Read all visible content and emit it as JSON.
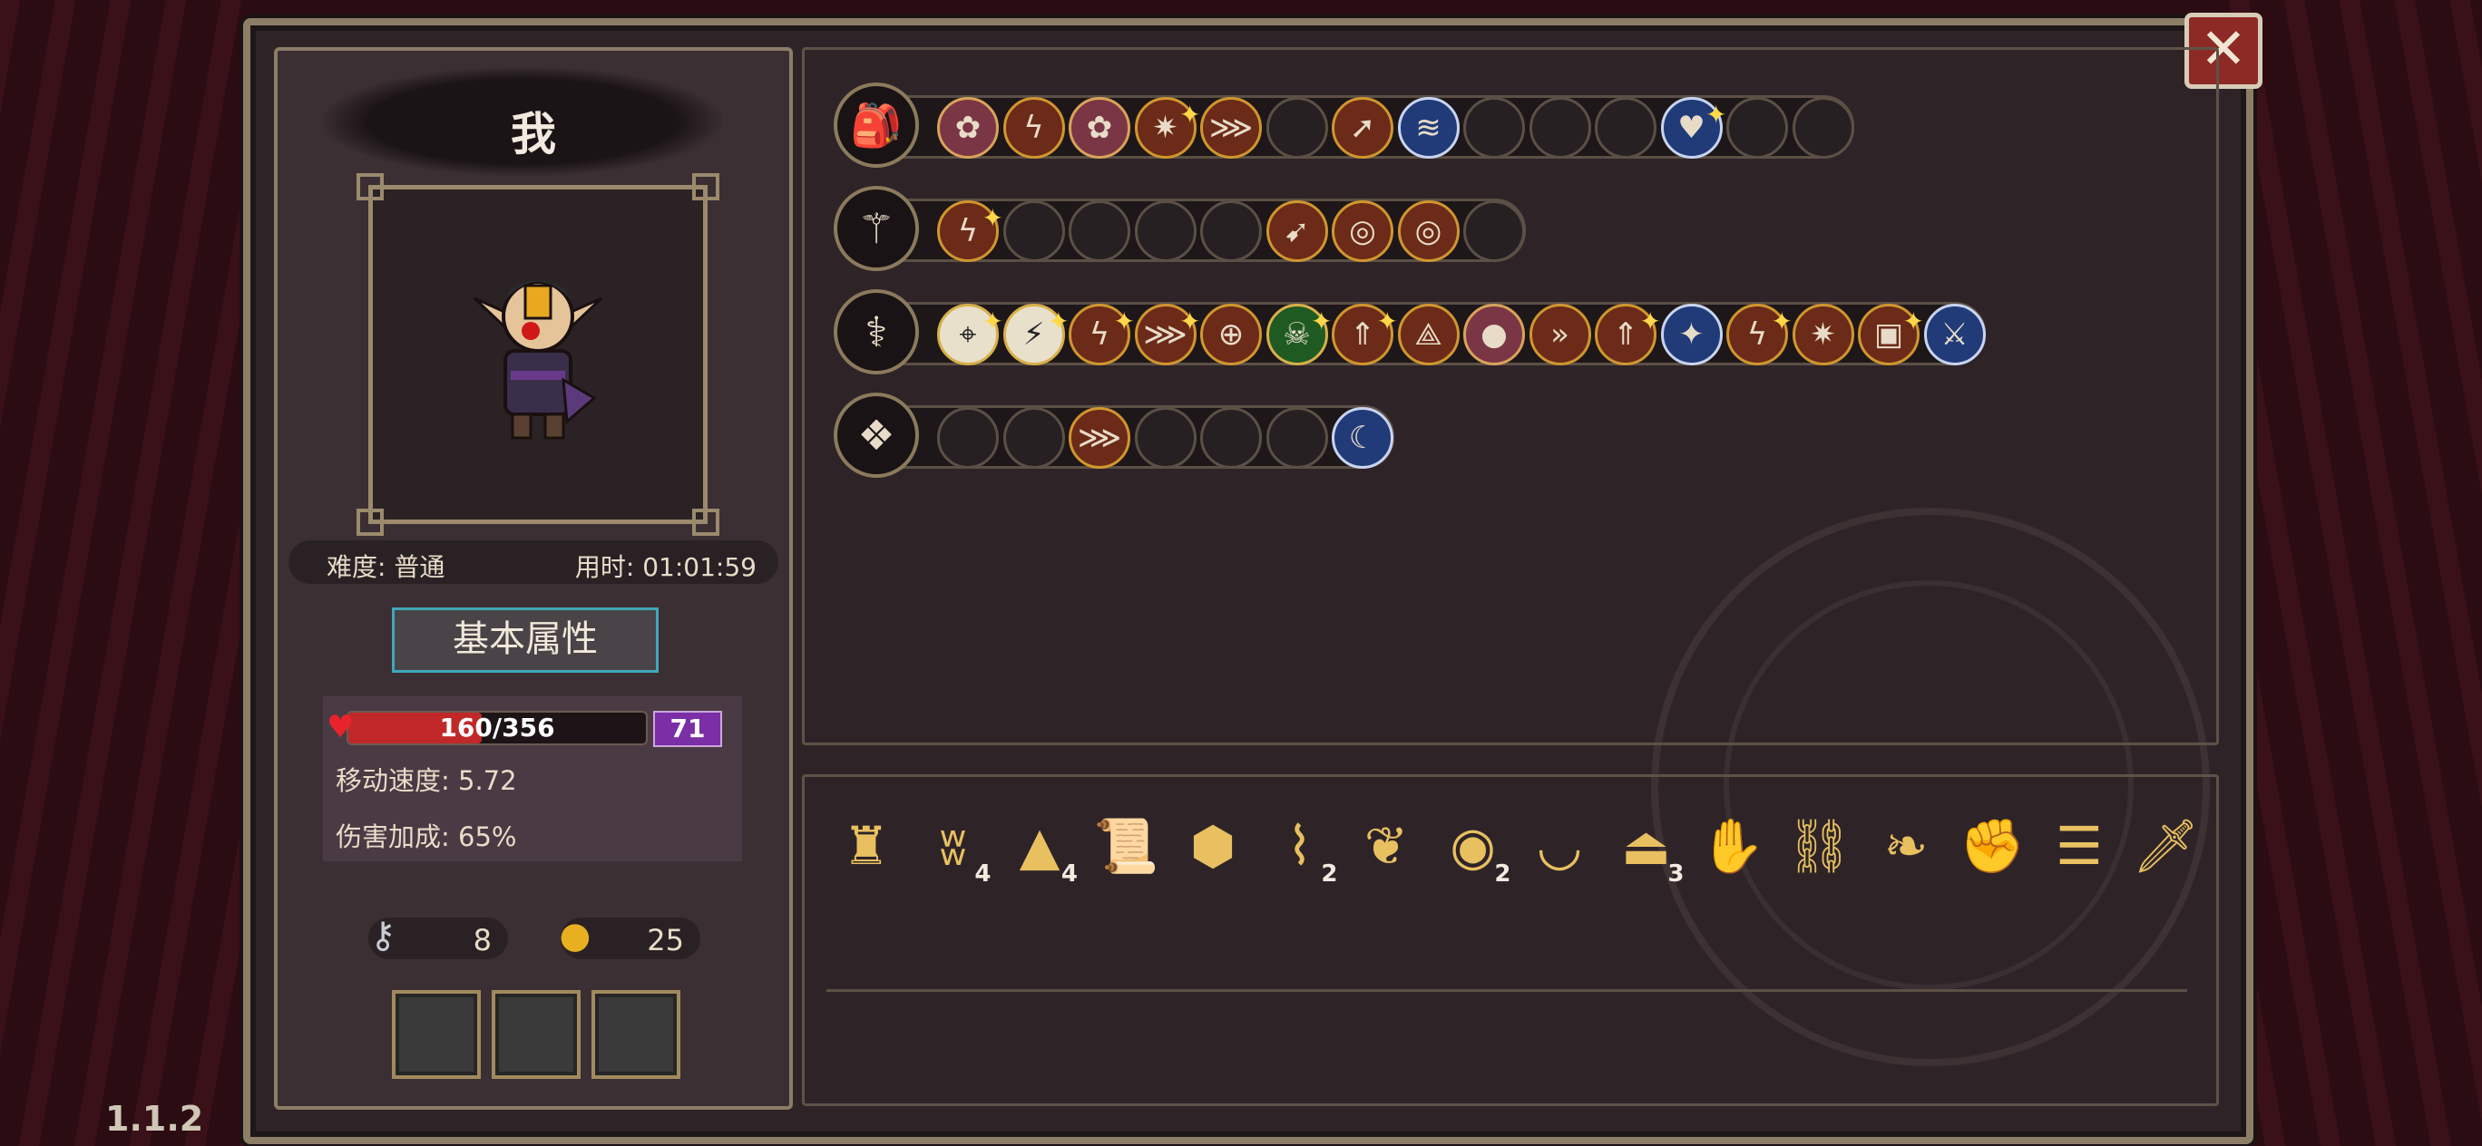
{
  "version": "1.1.2",
  "close_label": "✕",
  "character": {
    "name": "我",
    "difficulty": "难度: 普通",
    "time": "用时: 01:01:59",
    "attributes_button": "基本属性",
    "hp_text": "160/356",
    "hp_fraction": 0.449,
    "shield": "71",
    "move_speed": "移动速度: 5.72",
    "damage_bonus": "伤害加成: 65%",
    "keys": "8",
    "coins": "25"
  },
  "skill_rows": [
    {
      "weapon_icon": "backpack-icon",
      "glyph": "🎒",
      "skills": [
        {
          "icon": "lotus-icon",
          "glyph": "✿",
          "style": "pink"
        },
        {
          "icon": "lightning-icon",
          "glyph": "ϟ",
          "style": "fire"
        },
        {
          "icon": "lotus-icon",
          "glyph": "✿",
          "style": "pink"
        },
        {
          "icon": "burst-icon",
          "glyph": "✷",
          "style": "fire",
          "star": true
        },
        {
          "icon": "claw-icon",
          "glyph": "⋙",
          "style": "fire"
        },
        {
          "icon": "empty-slot-icon",
          "glyph": "",
          "style": ""
        },
        {
          "icon": "arrow-up-icon",
          "glyph": "➚",
          "style": "fire"
        },
        {
          "icon": "splash-icon",
          "glyph": "≋",
          "style": "blue"
        },
        {
          "icon": "empty-slot-icon",
          "glyph": "",
          "style": ""
        },
        {
          "icon": "empty-slot-icon",
          "glyph": "",
          "style": ""
        },
        {
          "icon": "empty-slot-icon",
          "glyph": "",
          "style": ""
        },
        {
          "icon": "shield-heart-icon",
          "glyph": "♥",
          "style": "blue",
          "star": true
        },
        {
          "icon": "empty-slot-icon",
          "glyph": "",
          "style": ""
        },
        {
          "icon": "empty-slot-icon",
          "glyph": "",
          "style": ""
        }
      ]
    },
    {
      "weapon_icon": "staff-icon",
      "glyph": "⚚",
      "skills": [
        {
          "icon": "lightning-icon",
          "glyph": "ϟ",
          "style": "fire",
          "star": true
        },
        {
          "icon": "empty-slot-icon",
          "glyph": "",
          "style": ""
        },
        {
          "icon": "empty-slot-icon",
          "glyph": "",
          "style": ""
        },
        {
          "icon": "empty-slot-icon",
          "glyph": "",
          "style": ""
        },
        {
          "icon": "empty-slot-icon",
          "glyph": "",
          "style": ""
        },
        {
          "icon": "rocket-icon",
          "glyph": "➹",
          "style": "fire"
        },
        {
          "icon": "target-icon",
          "glyph": "◎",
          "style": "fire"
        },
        {
          "icon": "target-icon",
          "glyph": "◎",
          "style": "fire"
        },
        {
          "icon": "empty-slot-icon",
          "glyph": "",
          "style": ""
        }
      ]
    },
    {
      "weapon_icon": "wand-icon",
      "glyph": "⚕",
      "skills": [
        {
          "icon": "mouse-icon",
          "glyph": "⌖",
          "style": "white",
          "star": true
        },
        {
          "icon": "card-icon",
          "glyph": "⚡",
          "style": "white",
          "star": true
        },
        {
          "icon": "lightning-icon",
          "glyph": "ϟ",
          "style": "fire",
          "star": true
        },
        {
          "icon": "claw-icon",
          "glyph": "⋙",
          "style": "fire",
          "star": true
        },
        {
          "icon": "crosshair-icon",
          "glyph": "⊕",
          "style": "fire"
        },
        {
          "icon": "skull-icon",
          "glyph": "☠",
          "style": "green",
          "star": true
        },
        {
          "icon": "arrow-up-icon",
          "glyph": "⇑",
          "style": "fire",
          "star": true
        },
        {
          "icon": "trident-icon",
          "glyph": "⟁",
          "style": "fire"
        },
        {
          "icon": "meat-icon",
          "glyph": "●",
          "style": "pink"
        },
        {
          "icon": "chevrons-icon",
          "glyph": "»",
          "style": "fire"
        },
        {
          "icon": "arrow-up-icon",
          "glyph": "⇑",
          "style": "fire",
          "star": true
        },
        {
          "icon": "sparkle-icon",
          "glyph": "✦",
          "style": "blue"
        },
        {
          "icon": "lightning-icon",
          "glyph": "ϟ",
          "style": "fire",
          "star": true
        },
        {
          "icon": "burst-icon",
          "glyph": "✷",
          "style": "fire"
        },
        {
          "icon": "chest-icon",
          "glyph": "▣",
          "style": "fire",
          "star": true
        },
        {
          "icon": "slash-icon",
          "glyph": "⚔",
          "style": "blue"
        }
      ]
    },
    {
      "weapon_icon": "crystal-icon",
      "glyph": "❖",
      "skills": [
        {
          "icon": "empty-slot-icon",
          "glyph": "",
          "style": ""
        },
        {
          "icon": "empty-slot-icon",
          "glyph": "",
          "style": ""
        },
        {
          "icon": "claw-icon",
          "glyph": "⋙",
          "style": "fire"
        },
        {
          "icon": "empty-slot-icon",
          "glyph": "",
          "style": ""
        },
        {
          "icon": "empty-slot-icon",
          "glyph": "",
          "style": ""
        },
        {
          "icon": "empty-slot-icon",
          "glyph": "",
          "style": ""
        },
        {
          "icon": "blade-icon",
          "glyph": "☾",
          "style": "blue"
        }
      ]
    }
  ],
  "items": [
    {
      "icon": "idol-icon",
      "glyph": "♜",
      "count": ""
    },
    {
      "icon": "teeth-icon",
      "glyph": "ʬ",
      "count": "4"
    },
    {
      "icon": "wizard-hat-icon",
      "glyph": "▲",
      "count": "4"
    },
    {
      "icon": "scroll-icon",
      "glyph": "📜",
      "count": ""
    },
    {
      "icon": "dice-icon",
      "glyph": "⬢",
      "count": ""
    },
    {
      "icon": "bone-icon",
      "glyph": "⌇",
      "count": "2"
    },
    {
      "icon": "shell-icon",
      "glyph": "❦",
      "count": ""
    },
    {
      "icon": "eye-icon",
      "glyph": "◉",
      "count": "2"
    },
    {
      "icon": "belt-icon",
      "glyph": "◡",
      "count": ""
    },
    {
      "icon": "cloak-icon",
      "glyph": "⏏",
      "count": "3"
    },
    {
      "icon": "glove-icon",
      "glyph": "✋",
      "count": ""
    },
    {
      "icon": "chain-icon",
      "glyph": "⛓",
      "count": ""
    },
    {
      "icon": "feather-icon",
      "glyph": "❧",
      "count": ""
    },
    {
      "icon": "gauntlet-icon",
      "glyph": "✊",
      "count": ""
    },
    {
      "icon": "ribcage-icon",
      "glyph": "☰",
      "count": ""
    },
    {
      "icon": "sword-icon",
      "glyph": "🗡",
      "count": ""
    }
  ],
  "colors": {
    "hp": "#c0282a",
    "shield": "#7a2fa6",
    "accent_teal": "#3fa8b8",
    "frame": "#8c7d66"
  }
}
